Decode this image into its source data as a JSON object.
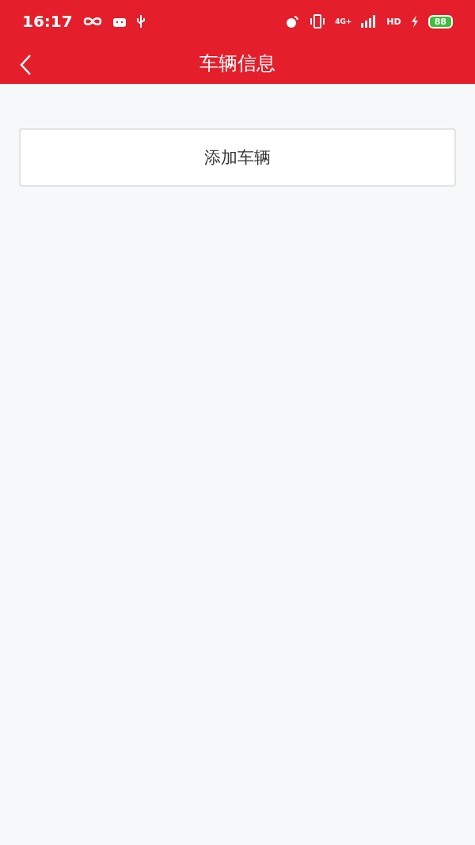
{
  "status_bar": {
    "time": "16:17",
    "network": "4G+",
    "hd": "HD",
    "battery": "88"
  },
  "header": {
    "title": "车辆信息"
  },
  "add_button": {
    "label": "添加车辆"
  }
}
